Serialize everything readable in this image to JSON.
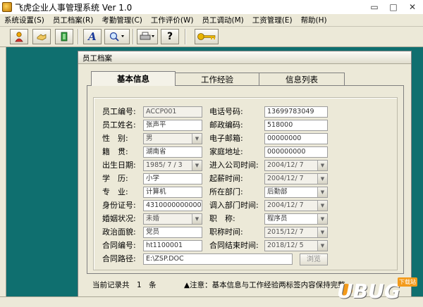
{
  "window": {
    "title": "飞虎企业人事管理系统 Ver 1.0",
    "controls": {
      "minimize": "▭",
      "maximize": "□",
      "close": "✕"
    }
  },
  "menu": [
    "系统设置(S)",
    "员工档案(R)",
    "考勤管理(C)",
    "工作评价(W)",
    "员工调动(M)",
    "工资管理(E)",
    "帮助(H)"
  ],
  "toolbar": {
    "icons": [
      "person-icon",
      "handshake-icon",
      "exit-door-icon",
      "font-icon",
      "find-icon",
      "printer-icon",
      "help-icon",
      "key-icon"
    ],
    "glyphs": {
      "font": "A",
      "help": "?"
    }
  },
  "child_window": {
    "title": "员工档案"
  },
  "tabs": [
    {
      "label": "基本信息",
      "active": true
    },
    {
      "label": "工作经验",
      "active": false
    },
    {
      "label": "信息列表",
      "active": false
    }
  ],
  "form": {
    "left": [
      {
        "label": "员工编号:",
        "value": "ACCP001"
      },
      {
        "label": "员工姓名:",
        "value": "张声平"
      },
      {
        "label": "性　别:",
        "value": "男"
      },
      {
        "label": "籍　贯:",
        "value": "湖南省"
      },
      {
        "label": "出生日期:",
        "value": "1985/ 7 / 3"
      },
      {
        "label": "学　历:",
        "value": "小学"
      },
      {
        "label": "专　业:",
        "value": "计算机"
      },
      {
        "label": "身份证号:",
        "value": "431000000000000000"
      },
      {
        "label": "婚姻状况:",
        "value": "未婚"
      },
      {
        "label": "政治面貌:",
        "value": "党员"
      },
      {
        "label": "合同编号:",
        "value": "ht1100001"
      }
    ],
    "right": [
      {
        "label": "电话号码:",
        "value": "13699783049"
      },
      {
        "label": "邮政编码:",
        "value": "518000"
      },
      {
        "label": "电子邮箱:",
        "value": "00000000"
      },
      {
        "label": "家庭地址:",
        "value": "000000000"
      },
      {
        "label": "进入公司时间:",
        "value": "2004/12/ 7"
      },
      {
        "label": "起薪时间:",
        "value": "2004/12/ 7"
      },
      {
        "label": "所在部门:",
        "value": "后勤部"
      },
      {
        "label": "调入部门时间:",
        "value": "2004/12/ 7"
      },
      {
        "label": "职　称:",
        "value": "程序员"
      },
      {
        "label": "职称时间:",
        "value": "2015/12/ 7"
      },
      {
        "label": "合同结束时间:",
        "value": "2018/12/ 5"
      }
    ],
    "path": {
      "label": "合同路径:",
      "value": "E:\\ZSP.DOC",
      "browse": "浏览"
    }
  },
  "status": {
    "record_text": "当前记录共　1　条",
    "note": "▲注意：基本信息与工作经验两标签内容保持完整"
  },
  "watermark": {
    "text": "UBUG",
    "badge": "下载站"
  }
}
